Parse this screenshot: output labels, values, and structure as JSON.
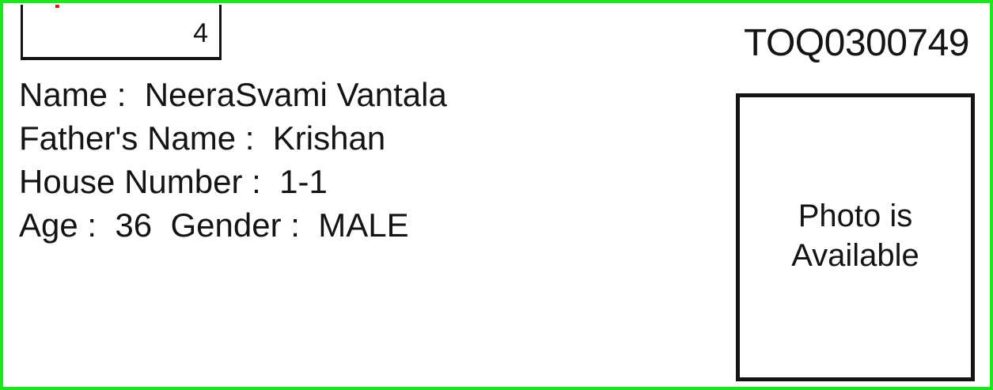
{
  "card": {
    "serial_number": "4",
    "epic_number": "TOQ0300749",
    "name_label": "Name :",
    "name_value": "NeeraSvami Vantala",
    "father_label": "Father's Name :",
    "father_value": "Krishan",
    "house_label": "House Number :",
    "house_value": "1-1",
    "age_label": "Age :",
    "age_value": "36",
    "gender_label": "Gender :",
    "gender_value": "MALE",
    "photo_line1": "Photo is",
    "photo_line2": "Available"
  },
  "colors": {
    "border": "#1ee61e",
    "text": "#141414",
    "mark": "#d22020"
  }
}
